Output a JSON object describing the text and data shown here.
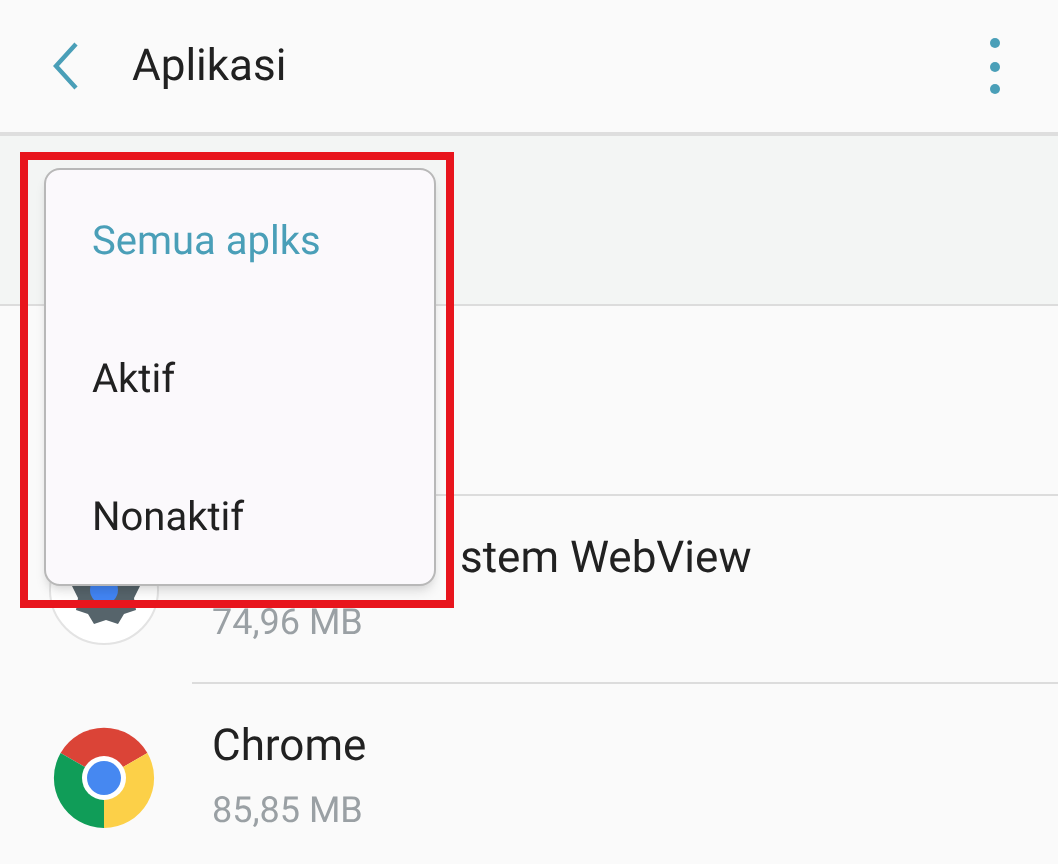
{
  "header": {
    "title": "Aplikasi"
  },
  "filter_menu": {
    "items": [
      {
        "label": "Semua aplks",
        "selected": true
      },
      {
        "label": "Aktif",
        "selected": false
      },
      {
        "label": "Nonaktif",
        "selected": false
      }
    ]
  },
  "apps": [
    {
      "kind": "covered",
      "name": "stem WebView",
      "size": "74,96 MB"
    },
    {
      "kind": "plain",
      "name": "Chrome",
      "size": "85,85 MB"
    }
  ]
}
